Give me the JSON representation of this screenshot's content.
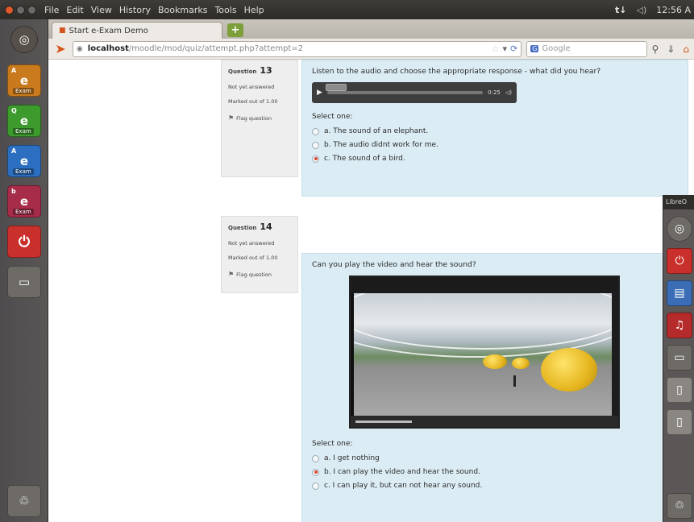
{
  "menubar": {
    "items": [
      "File",
      "Edit",
      "View",
      "History",
      "Bookmarks",
      "Tools",
      "Help"
    ],
    "indicator": "t↓",
    "volume": "◁)",
    "clock": "12:56 A"
  },
  "launcher": {
    "apps": [
      {
        "name": "dash",
        "glyph": "◎",
        "color": "#55504a"
      },
      {
        "name": "exam-a",
        "glyph": "e",
        "tag": "A",
        "label": "Exam",
        "color": "#c87a1c"
      },
      {
        "name": "exam-q",
        "glyph": "e",
        "tag": "Q",
        "label": "Exam",
        "color": "#3d9a2d"
      },
      {
        "name": "exam-blue",
        "glyph": "e",
        "tag": "A",
        "label": "Exam",
        "color": "#2c6fc0"
      },
      {
        "name": "exam-red",
        "glyph": "e",
        "tag": "b",
        "label": "Exam",
        "color": "#a62c4a"
      },
      {
        "name": "shutdown",
        "glyph": "⏻",
        "color": "#c9302c"
      },
      {
        "name": "workspace",
        "glyph": "▭",
        "color": "#6e6b66"
      },
      {
        "name": "trash",
        "glyph": "♲",
        "color": "#6e6b66"
      }
    ]
  },
  "browser": {
    "tab_title": "Start e-Exam Demo",
    "new_tab": "+",
    "url_host": "localhost",
    "url_path": "/moodle/mod/quiz/attempt.php?attempt=2",
    "search_placeholder": "Google"
  },
  "questions": [
    {
      "label": "Question",
      "number": "13",
      "state": "Not yet answered",
      "mark": "Marked out of 1.00",
      "flag": "Flag question",
      "text": "Listen to the audio and choose the appropriate response - what did you hear?",
      "media": "audio",
      "audio_time": "0:25",
      "select_label": "Select one:",
      "options": [
        {
          "text": "a. The sound of an elephant.",
          "selected": false
        },
        {
          "text": "b. The audio didnt work for me.",
          "selected": false
        },
        {
          "text": "c. The sound of a bird.",
          "selected": true
        }
      ]
    },
    {
      "label": "Question",
      "number": "14",
      "state": "Not yet answered",
      "mark": "Marked out of 1.00",
      "flag": "Flag question",
      "text": "Can you play the video and hear the sound?",
      "media": "video",
      "select_label": "Select one:",
      "options": [
        {
          "text": "a. I get nothing",
          "selected": false
        },
        {
          "text": "b. I can play the video and hear the sound.",
          "selected": true
        },
        {
          "text": "c. I can play it, but can not hear any sound.",
          "selected": false
        }
      ]
    }
  ],
  "right_panel": {
    "title": "LibreO"
  }
}
